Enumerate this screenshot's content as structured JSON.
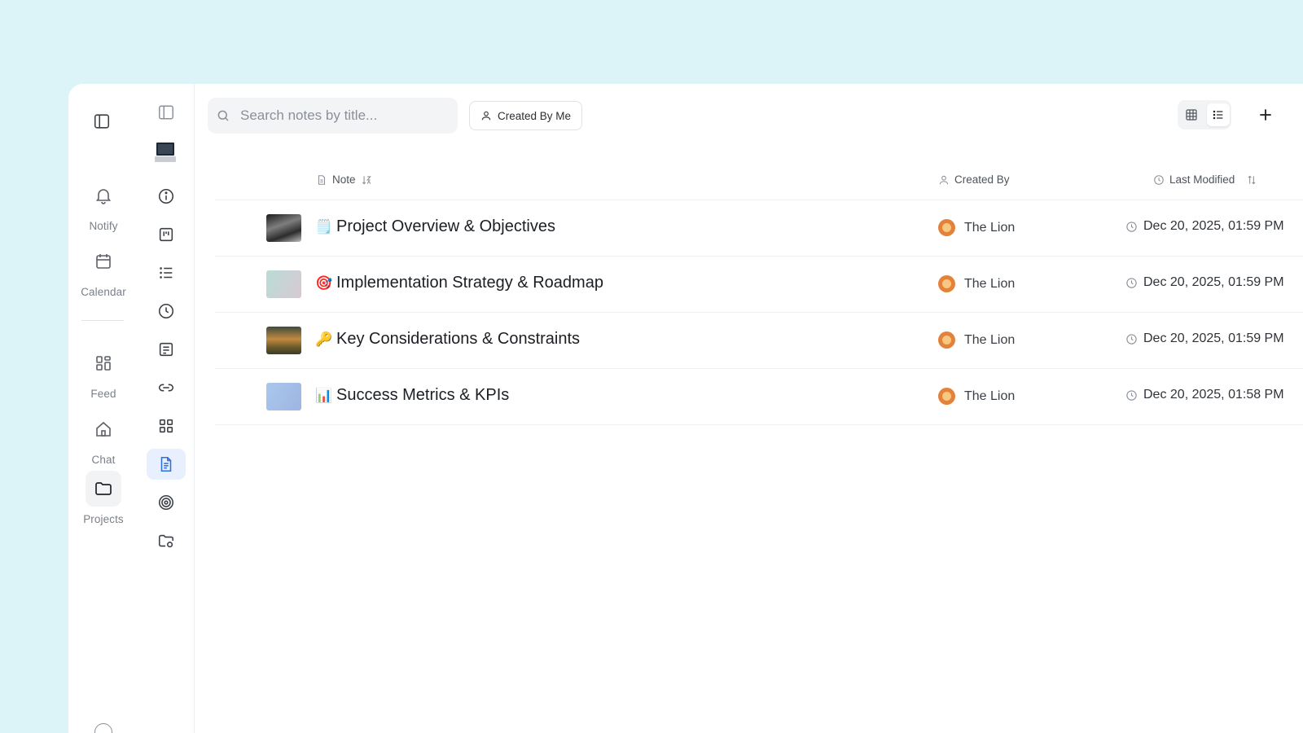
{
  "rail": {
    "items": [
      {
        "id": "notify",
        "label": "Notify",
        "icon": "bell-icon"
      },
      {
        "id": "calendar",
        "label": "Calendar",
        "icon": "calendar-icon"
      },
      {
        "id": "feed",
        "label": "Feed",
        "icon": "grid-icon"
      },
      {
        "id": "chat",
        "label": "Chat",
        "icon": "home-icon"
      },
      {
        "id": "projects",
        "label": "Projects",
        "icon": "folder-icon",
        "active": true
      }
    ]
  },
  "subrail": {
    "icons": [
      "sidebar-toggle-icon",
      "laptop-thumbnail",
      "info-icon",
      "kanban-icon",
      "list-icon",
      "clock-icon",
      "document-list-icon",
      "link-icon",
      "apps-grid-icon",
      "notes-icon",
      "target-icon",
      "folder-settings-icon"
    ],
    "active": "notes-icon"
  },
  "toolbar": {
    "search_placeholder": "Search notes by title...",
    "filter_label": "Created By Me",
    "view_modes": [
      "grid",
      "list"
    ],
    "active_view": "list"
  },
  "table": {
    "columns": {
      "note": "Note",
      "created_by": "Created By",
      "last_modified": "Last Modified"
    },
    "rows": [
      {
        "emoji": "🗒️",
        "title": "Project Overview & Objectives",
        "author": "The Lion",
        "modified": "Dec 20, 2025, 01:59 PM"
      },
      {
        "emoji": "🎯",
        "title": "Implementation Strategy & Roadmap",
        "author": "The Lion",
        "modified": "Dec 20, 2025, 01:59 PM"
      },
      {
        "emoji": "🔑",
        "title": "Key Considerations & Constraints",
        "author": "The Lion",
        "modified": "Dec 20, 2025, 01:59 PM"
      },
      {
        "emoji": "📊",
        "title": "Success Metrics & KPIs",
        "author": "The Lion",
        "modified": "Dec 20, 2025, 01:58 PM"
      }
    ]
  },
  "colors": {
    "background": "#dcf4f8",
    "accent": "#2f6fe0",
    "active_bg": "#e9f0fd"
  }
}
